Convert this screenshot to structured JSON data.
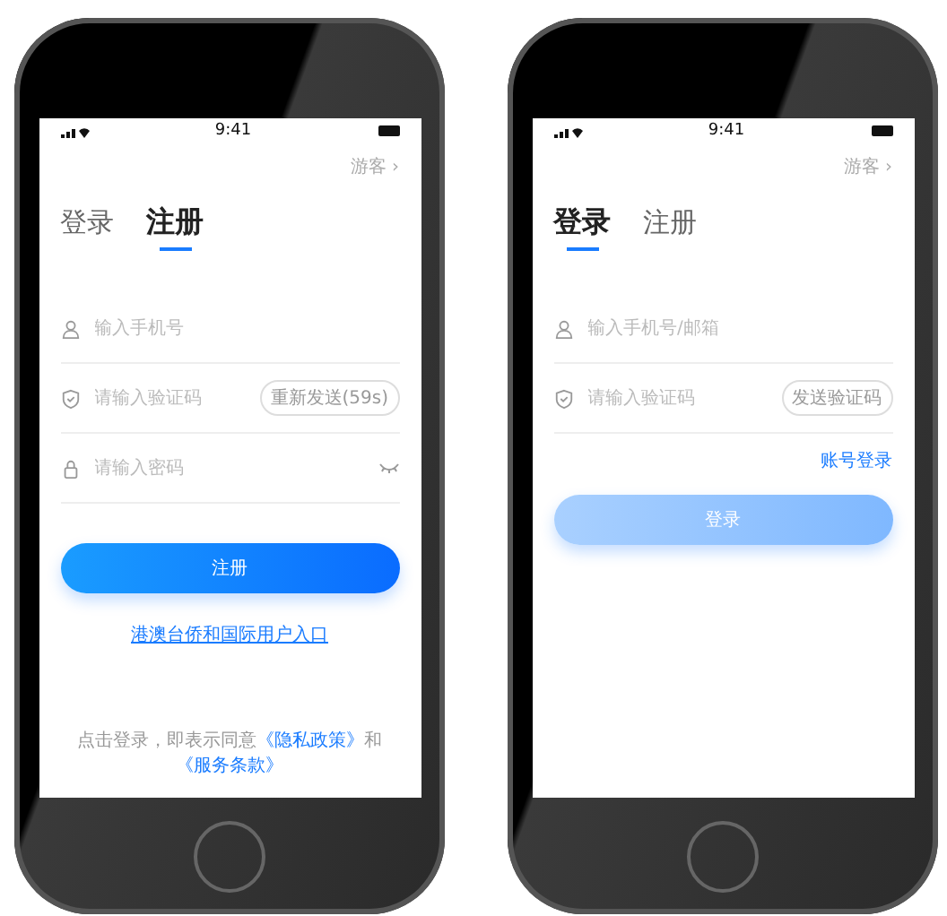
{
  "phones": [
    {
      "status_bar": {
        "time": "9:41"
      },
      "guest_link": "游客 ›",
      "tabs": [
        {
          "label": "登录",
          "selected": false
        },
        {
          "label": "注册",
          "selected": true
        }
      ],
      "fields": [
        {
          "kind": "phone",
          "placeholder": "输入手机号"
        },
        {
          "kind": "code",
          "placeholder": "请输入验证码",
          "action": "重新发送(59s)"
        },
        {
          "kind": "password",
          "placeholder": "请输入密码"
        }
      ],
      "submit": {
        "label": "注册",
        "disabled": false
      },
      "intl_link": "港澳台侨和国际用户入口",
      "agreement": {
        "text": "点击登录，即表示同意",
        "privacy": "《隐私政策》",
        "and": "和",
        "terms": "《服务条款》"
      }
    },
    {
      "status_bar": {
        "time": "9:41"
      },
      "guest_link": "游客 ›",
      "tabs": [
        {
          "label": "登录",
          "selected": true
        },
        {
          "label": "注册",
          "selected": false
        }
      ],
      "fields": [
        {
          "kind": "phone",
          "placeholder": "输入手机号/邮箱"
        },
        {
          "kind": "code",
          "placeholder": "请输入验证码",
          "action": "发送验证码"
        }
      ],
      "account_link": "账号登录",
      "submit": {
        "label": "登录",
        "disabled": true
      }
    }
  ]
}
